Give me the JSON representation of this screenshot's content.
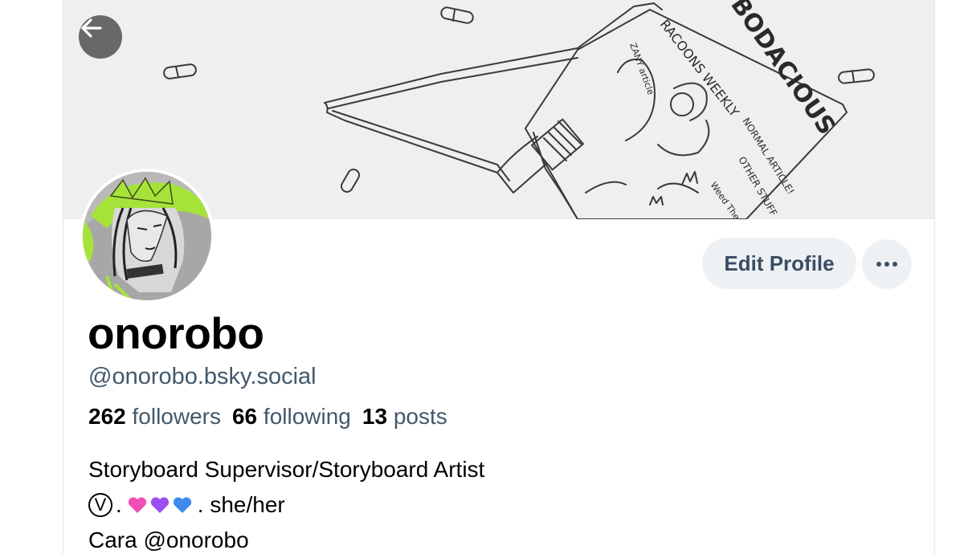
{
  "profile": {
    "display_name": "onorobo",
    "handle": "@onorobo.bsky.social",
    "stats": {
      "followers_count": "262",
      "followers_label": "followers",
      "following_count": "66",
      "following_label": "following",
      "posts_count": "13",
      "posts_label": "posts"
    },
    "bio": {
      "line1": "Storyboard Supervisor/Storyboard Artist",
      "line2_symbol": "V",
      "line2_sep1": ".",
      "line2_sep2": ". she/her",
      "line3": "Cara @onorobo"
    }
  },
  "banner": {
    "magazine_title": "BODACIOUS",
    "magazine_subtitle": "RACOONS WEEKLY",
    "note_zany": "ZANY article",
    "note_normal": "NORMAL ARTICLE!",
    "note_other": "OTHER STUFF",
    "note_weed": "Weed Theme"
  },
  "actions": {
    "edit_profile_label": "Edit Profile",
    "more_icon": "ellipsis-icon",
    "back_icon": "arrow-left-icon"
  },
  "colors": {
    "heart_pink": "#f04fb4",
    "heart_purple": "#9b4ff0",
    "heart_blue": "#3d8bf0",
    "avatar_accent": "#a6e33a",
    "handle_text": "#42576c"
  }
}
